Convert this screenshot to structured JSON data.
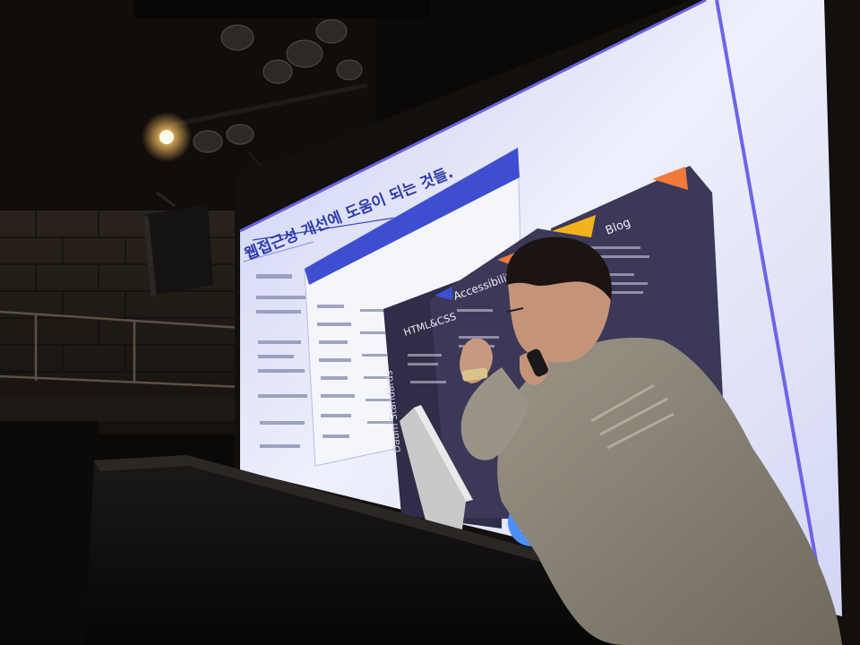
{
  "slide": {
    "title": "웹접근성 개선에 도움이 되는 것들.",
    "panel_labels": [
      "HTML&CSS",
      "Accessibility",
      "Blog"
    ],
    "vertical_brand": "Daum Standards"
  },
  "colors": {
    "screen": "#d9dcf6",
    "slide_accent": "#3442b8",
    "panel_dark": "#3b3858",
    "panel_blue": "#3d4ed0",
    "orange": "#f07a3a",
    "yellow": "#f3b21b",
    "shirt": "#8f887d"
  }
}
